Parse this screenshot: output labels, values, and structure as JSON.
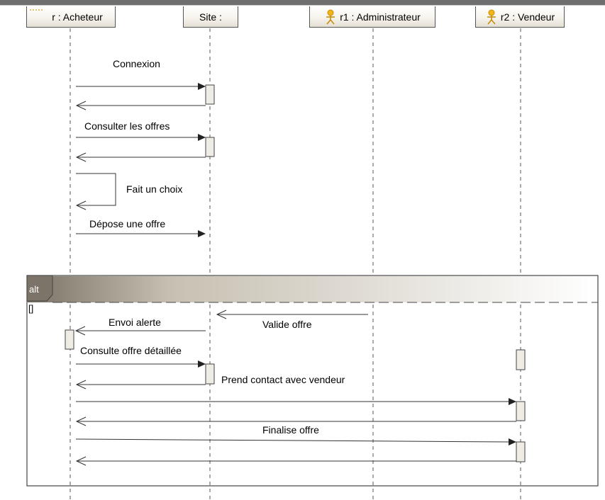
{
  "lifelines": [
    {
      "name": "r : Acheteur",
      "actor": false
    },
    {
      "name": "Site :",
      "actor": false
    },
    {
      "name": "r1 : Administrateur",
      "actor": true
    },
    {
      "name": "r2 : Vendeur",
      "actor": true
    }
  ],
  "messages": {
    "connexion": "Connexion",
    "consulter": "Consulter les offres",
    "choix": "Fait un choix",
    "depose": "Dépose une offre",
    "envoi": "Envoi alerte",
    "valide": "Valide offre",
    "consulte": "Consulte offre détaillée",
    "contact": "Prend contact avec vendeur",
    "finalise": "Finalise offre"
  },
  "fragment": {
    "operator": "alt",
    "guard": "[]"
  },
  "colors": {
    "actor_icon": "#f2b418",
    "line": "#3a3a3a",
    "alt_header": "#8a8276",
    "activation_fill": "#efece6"
  }
}
